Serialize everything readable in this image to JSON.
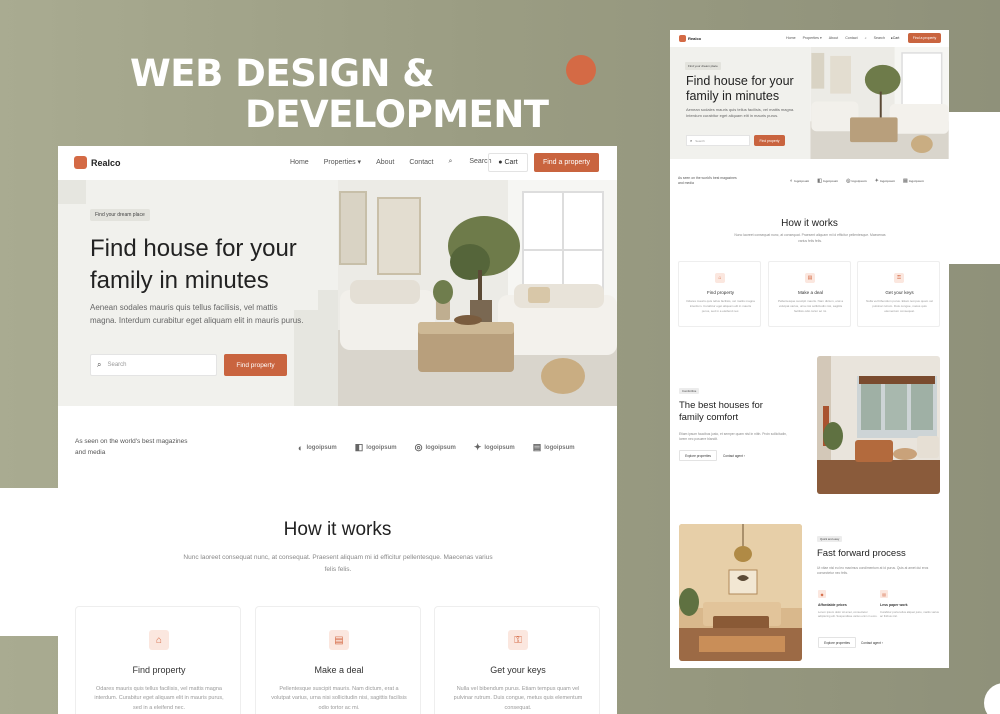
{
  "headline": {
    "line1": "WEB DESIGN &",
    "line2": "DEVELOPMENT"
  },
  "brand": "Realco",
  "nav": {
    "home": "Home",
    "properties": "Properties ▾",
    "about": "About",
    "contact": "Contact",
    "search": "Search",
    "cart": "Cart",
    "cta": "Find a property"
  },
  "hero": {
    "chip": "Find your dream place",
    "title": "Find house for your family in minutes",
    "lead": "Aenean sodales mauris quis tellus facilisis, vel mattis magna. Interdum curabitur eget aliquam elit in mauris purus.",
    "search_placeholder": "Search",
    "search_button": "Find property"
  },
  "trust": {
    "text": "As seen on the world's best magazines and media",
    "partners": [
      "logoipsum",
      "logoipsum",
      "logoipsum",
      "logoipsum",
      "logoipsum"
    ]
  },
  "how_it_works": {
    "title": "How it works",
    "subtitle": "Nunc laoreet consequat nunc, at consequat. Praesent aliquam mi id efficitur pellentesque. Maecenas varius felis felis.",
    "cards": [
      {
        "icon": "home-icon",
        "title": "Find property",
        "text": "Odares mauris quis tellus facilisis, vel mattis magna interdum. Curabitur eget aliquam elit in mauris purus, sed in a eleifend nec."
      },
      {
        "icon": "document-icon",
        "title": "Make a deal",
        "text": "Pellentesque suscipit mauris. Nam dictum, erat a volutpat varius, urna nisi sollicitudin nisi, sagittis facilisis odio tortor ac mi."
      },
      {
        "icon": "key-icon",
        "title": "Get your keys",
        "text": "Nulla vel bibendum purus. Etiam tempus quam vel pulvinar rutrum. Duis congue, metus quis elementum consequat."
      }
    ]
  },
  "comfort": {
    "chip": "Comfortline",
    "title": "The best houses for family comfort",
    "text": "Etiam ipsum faucibus justo, et semper quam nisl in nibh. Proin sollicitudin, lorem nec posuere blandit.",
    "explore": "Explore properties",
    "contact": "Contact agent ›"
  },
  "process": {
    "chip": "Quick and easy",
    "title": "Fast forward process",
    "text": "Ut vitae nisl eu leo maximus condimentum at id purus. Quis at amet dui eros consectetur nec felis.",
    "f1_title": "Affordable prices",
    "f1_text": "Lorem ipsum dolor sit amet, consectetur adipiscing elit. Suspendisse varius enim in eros.",
    "f2_title": "Less paper work",
    "f2_text": "Curabitur porta tellus aliquet justo, mattis varius ac finibus nisl.",
    "explore": "Explore properties",
    "contact": "Contact agent ›"
  },
  "colors": {
    "accent": "#d46a45",
    "button": "#c9643f",
    "background": "#9fa088",
    "hero_bg": "#f1f1ed"
  }
}
